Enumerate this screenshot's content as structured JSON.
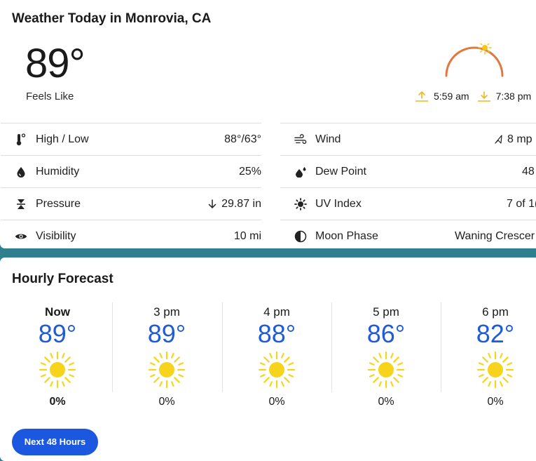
{
  "today": {
    "title": "Weather Today in Monrovia, CA",
    "temperature": "89°",
    "feels_like_label": "Feels Like",
    "sunrise": "5:59 am",
    "sunset": "7:38 pm",
    "details_left": [
      {
        "icon": "thermometer-icon",
        "label": "High / Low",
        "value": "88°/63°"
      },
      {
        "icon": "humidity-drop-icon",
        "label": "Humidity",
        "value": "25%"
      },
      {
        "icon": "pressure-icon",
        "label": "Pressure",
        "value": "29.87 in",
        "trend_icon": "arrow-down-icon"
      },
      {
        "icon": "eye-icon",
        "label": "Visibility",
        "value": "10 mi"
      }
    ],
    "details_right": [
      {
        "icon": "wind-icon",
        "label": "Wind",
        "value": "8 mp",
        "direction_icon": "wind-direction-arrow-icon"
      },
      {
        "icon": "dew-point-icon",
        "label": "Dew Point",
        "value": "48"
      },
      {
        "icon": "uv-sun-icon",
        "label": "UV Index",
        "value": "7 of 1("
      },
      {
        "icon": "moon-phase-icon",
        "label": "Moon Phase",
        "value": "Waning Crescer"
      }
    ],
    "colors": {
      "arc": "#e0793f",
      "sun": "#f5c518",
      "accent": "#f3b61f"
    }
  },
  "hourly": {
    "title": "Hourly Forecast",
    "hours": [
      {
        "label": "Now",
        "temp": "89°",
        "precip": "0%",
        "icon": "sunny-icon"
      },
      {
        "label": "3 pm",
        "temp": "89°",
        "precip": "0%",
        "icon": "sunny-icon"
      },
      {
        "label": "4 pm",
        "temp": "88°",
        "precip": "0%",
        "icon": "sunny-icon"
      },
      {
        "label": "5 pm",
        "temp": "86°",
        "precip": "0%",
        "icon": "sunny-icon"
      },
      {
        "label": "6 pm",
        "temp": "82°",
        "precip": "0%",
        "icon": "sunny-icon"
      }
    ],
    "next_button": "Next 48 Hours",
    "colors": {
      "temp": "#1f5bd9",
      "button": "#1c58df",
      "sun": "#f7d41c"
    }
  }
}
